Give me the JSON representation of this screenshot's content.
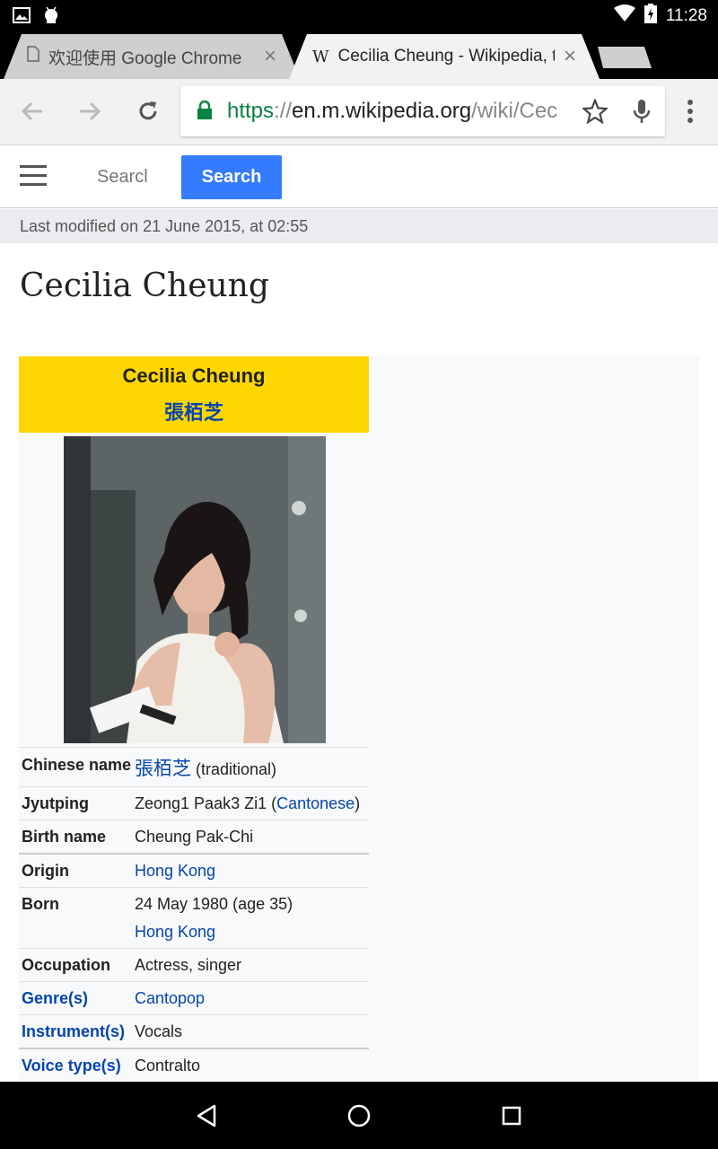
{
  "status_bar": {
    "time": "11:28",
    "icons": [
      "image-icon",
      "android-icon",
      "wifi-icon",
      "battery-charging-icon"
    ]
  },
  "tabs": [
    {
      "title": "欢迎使用 Google Chrome",
      "icon": "page-icon",
      "active": false
    },
    {
      "title": "Cecilia Cheung - Wikipedia, t",
      "icon": "wikipedia-icon",
      "active": true
    }
  ],
  "toolbar": {
    "url_scheme": "https",
    "url_sep": "://",
    "url_host": "en.m.wikipedia.org",
    "url_path": "/wiki/Cec",
    "icons": [
      "back-icon",
      "forward-icon",
      "reload-icon",
      "lock-icon",
      "star-icon",
      "mic-icon",
      "menu-icon"
    ]
  },
  "wiki": {
    "search_placeholder": "Searcl",
    "search_button": "Search",
    "last_modified": "Last modified on 21 June 2015, at 02:55",
    "title": "Cecilia Cheung"
  },
  "infobox": {
    "name_en": "Cecilia Cheung",
    "name_zh": "張栢芝",
    "rows": [
      {
        "label": "Chinese name",
        "value_link": "張栢芝",
        "value_after": " (traditional)"
      },
      {
        "label": "Jyutping",
        "value": "Zeong1 Paak3 Zi1 (",
        "value_link": "Cantonese",
        "value_after": ")"
      },
      {
        "label": "Birth name",
        "value": "Cheung Pak-Chi"
      },
      {
        "label": "Origin",
        "value_link": "Hong Kong"
      },
      {
        "label": "Born",
        "value": "24 May 1980 (age 35)",
        "value_link": "Hong Kong"
      },
      {
        "label": "Occupation",
        "value": "Actress, singer"
      },
      {
        "label": "Genre(s)",
        "value_link": "Cantopop"
      },
      {
        "label": "Instrument(s)",
        "value": "Vocals"
      },
      {
        "label": "Voice type(s)",
        "value": "Contralto"
      }
    ]
  },
  "nav_bar": {
    "icons": [
      "back-triangle-icon",
      "home-circle-icon",
      "recents-square-icon"
    ]
  }
}
